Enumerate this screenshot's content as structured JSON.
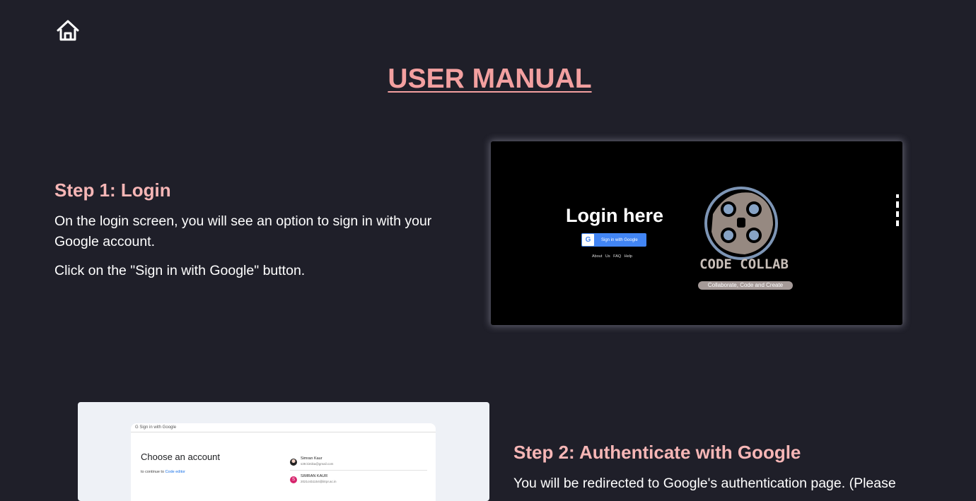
{
  "header": {
    "home_icon": "home-icon"
  },
  "page_title": "USER MANUAL",
  "step1": {
    "heading": "Step 1: Login",
    "paragraph1": "On the login screen, you will see an option to sign in with your Google account.",
    "paragraph2": "Click on the \"Sign in with Google\" button.",
    "screenshot": {
      "title": "Login here",
      "google_letter": "G",
      "button_label": "Sign in with Google",
      "links": "About Us  FAQ  Help",
      "logo_text": "CODE COLLAB",
      "tagline": "Collaborate, Code and Create"
    }
  },
  "step2": {
    "heading": "Step 2: Authenticate with Google",
    "paragraph1": "You will be redirected to Google's authentication page. (Please",
    "screenshot": {
      "top_label": "G  Sign in with Google",
      "title": "Choose an account",
      "continue_prefix": "to continue to ",
      "continue_link": "Code editor",
      "accounts": [
        {
          "name": "Simran Kaur",
          "email": "s39.kimika@gmail.com"
        },
        {
          "name": "SIMRAN KAUR",
          "email": "2021csb1154@iitrpr.ac.in",
          "initial": "S"
        }
      ]
    }
  },
  "colors": {
    "background": "#1f1f29",
    "title": "#f3a0a0",
    "heading": "#f6b6b6",
    "text": "#ffffff"
  }
}
